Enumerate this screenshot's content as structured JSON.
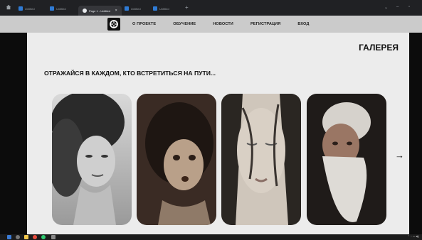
{
  "browser": {
    "tabs": [
      {
        "label": "Untitled"
      },
      {
        "label": "Untitled"
      },
      {
        "label": "Page 1 - Untitled",
        "active": true
      },
      {
        "label": "Untitled"
      },
      {
        "label": "Untitled"
      }
    ]
  },
  "navbar": {
    "links": [
      "О ПРОЕКТЕ",
      "ОБУЧЕНИЕ",
      "НОВОСТИ",
      "РЕГИСТРАЦИЯ",
      "ВХОД"
    ]
  },
  "main": {
    "section_title": "ГАЛЕРЕЯ",
    "tagline": "ОТРАЖАЙСЯ В КАЖДОМ, КТО ВСТРЕТИТЬСЯ НА ПУТИ...",
    "gallery": [
      {
        "name": "portrait-woman-curly-hair"
      },
      {
        "name": "portrait-girl"
      },
      {
        "name": "portrait-woman-eyes-closed"
      },
      {
        "name": "portrait-old-man-beard"
      }
    ],
    "next_arrow": "→"
  },
  "icons": {
    "home": "home-icon",
    "logo": "logo-icon",
    "next": "arrow-right-icon"
  }
}
